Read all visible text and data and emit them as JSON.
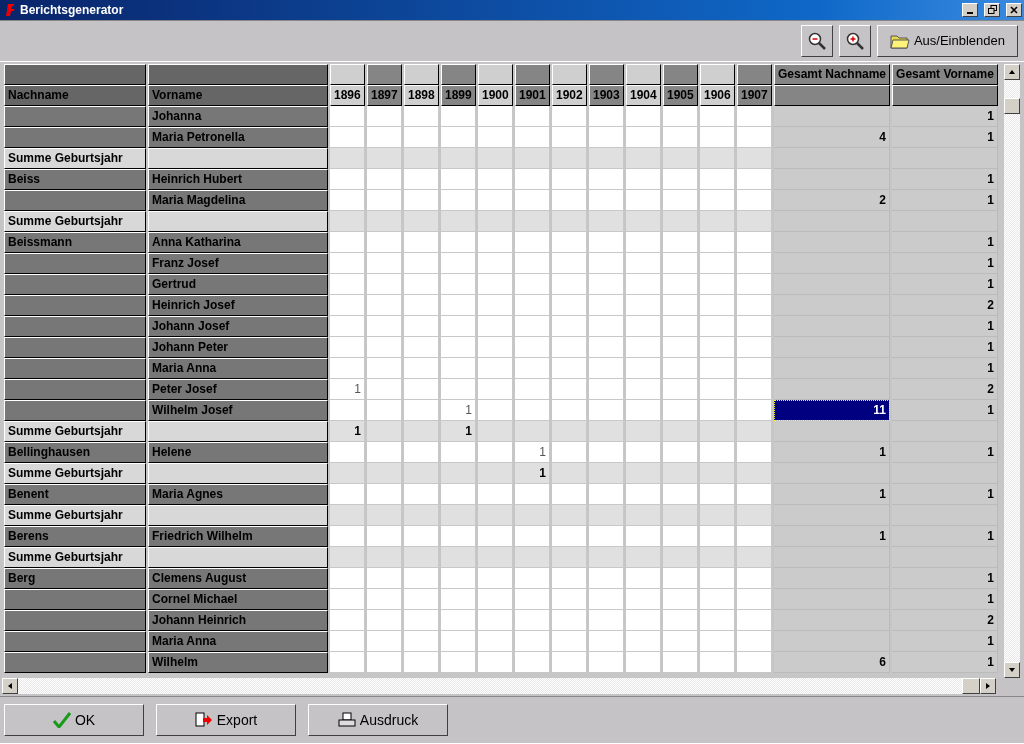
{
  "window": {
    "title": "Berichtsgenerator"
  },
  "toolbar": {
    "buttons": [
      {
        "kind": "zoom_out"
      },
      {
        "kind": "zoom_in"
      },
      {
        "kind": "folder",
        "label": "Aus/Einblenden"
      }
    ]
  },
  "table": {
    "name_columns": [
      "Nachname",
      "Vorname"
    ],
    "years": [
      "1896",
      "1897",
      "1898",
      "1899",
      "1900",
      "1901",
      "1902",
      "1903",
      "1904",
      "1905",
      "1906",
      "1907"
    ],
    "total_columns": [
      "Gesamt Nachname",
      "Gesamt Vorname"
    ],
    "rows": [
      {
        "kind": "person",
        "vorname": "Johanna",
        "total_vorname": "1",
        "total_selected": false
      },
      {
        "kind": "person",
        "vorname": "Maria Petronella",
        "total_nachname": "4",
        "total_vorname": "1",
        "total_selected": false
      },
      {
        "kind": "sum",
        "nachname": "Summe Geburtsjahr",
        "total_selected": false
      },
      {
        "kind": "person",
        "nachname": "Beiss",
        "vorname": "Heinrich Hubert",
        "total_vorname": "1",
        "total_selected": false
      },
      {
        "kind": "person",
        "vorname": "Maria Magdelina",
        "total_nachname": "2",
        "total_vorname": "1",
        "total_selected": false
      },
      {
        "kind": "sum",
        "nachname": "Summe Geburtsjahr",
        "total_selected": false
      },
      {
        "kind": "person",
        "nachname": "Beissmann",
        "vorname": "Anna Katharina",
        "total_vorname": "1",
        "total_selected": false
      },
      {
        "kind": "person",
        "vorname": "Franz Josef",
        "total_vorname": "1",
        "total_selected": false
      },
      {
        "kind": "person",
        "vorname": "Gertrud",
        "total_vorname": "1",
        "total_selected": false
      },
      {
        "kind": "person",
        "vorname": "Heinrich Josef",
        "total_vorname": "2",
        "total_selected": false
      },
      {
        "kind": "person",
        "vorname": "Johann Josef",
        "total_vorname": "1",
        "total_selected": false
      },
      {
        "kind": "person",
        "vorname": "Johann Peter",
        "total_vorname": "1",
        "total_selected": false
      },
      {
        "kind": "person",
        "vorname": "Maria Anna",
        "total_vorname": "1",
        "total_selected": false
      },
      {
        "kind": "person",
        "vorname": "Peter Josef",
        "counts": {
          "1896": "1"
        },
        "total_vorname": "2",
        "total_selected": false
      },
      {
        "kind": "person",
        "vorname": "Wilhelm Josef",
        "counts": {
          "1899": "1"
        },
        "total_nachname": "11",
        "total_vorname": "1",
        "total_selected": true
      },
      {
        "kind": "sum",
        "nachname": "Summe Geburtsjahr",
        "counts": {
          "1896": "1",
          "1899": "1"
        },
        "total_selected": false
      },
      {
        "kind": "person",
        "nachname": "Bellinghausen",
        "vorname": "Helene",
        "counts": {
          "1901": "1"
        },
        "total_nachname": "1",
        "total_vorname": "1",
        "total_selected": false
      },
      {
        "kind": "sum",
        "nachname": "Summe Geburtsjahr",
        "counts": {
          "1901": "1"
        },
        "total_selected": false
      },
      {
        "kind": "person",
        "nachname": "Benent",
        "vorname": "Maria Agnes",
        "total_nachname": "1",
        "total_vorname": "1",
        "total_selected": false
      },
      {
        "kind": "sum",
        "nachname": "Summe Geburtsjahr",
        "total_selected": false
      },
      {
        "kind": "person",
        "nachname": "Berens",
        "vorname": "Friedrich Wilhelm",
        "total_nachname": "1",
        "total_vorname": "1",
        "total_selected": false
      },
      {
        "kind": "sum",
        "nachname": "Summe Geburtsjahr",
        "total_selected": false
      },
      {
        "kind": "person",
        "nachname": "Berg",
        "vorname": "Clemens August",
        "total_vorname": "1",
        "total_selected": false
      },
      {
        "kind": "person",
        "vorname": "Cornel Michael",
        "total_vorname": "1",
        "total_selected": false
      },
      {
        "kind": "person",
        "vorname": "Johann Heinrich",
        "total_vorname": "2",
        "total_selected": false
      },
      {
        "kind": "person",
        "vorname": "Maria Anna",
        "total_vorname": "1",
        "total_selected": false
      },
      {
        "kind": "person",
        "vorname": "Wilhelm",
        "total_nachname": "6",
        "total_vorname": "1",
        "total_selected": false
      }
    ]
  },
  "footer": {
    "buttons": [
      {
        "kind": "ok",
        "label": "OK"
      },
      {
        "kind": "export",
        "label": "Export"
      },
      {
        "kind": "print",
        "label": "Ausdruck"
      }
    ]
  }
}
